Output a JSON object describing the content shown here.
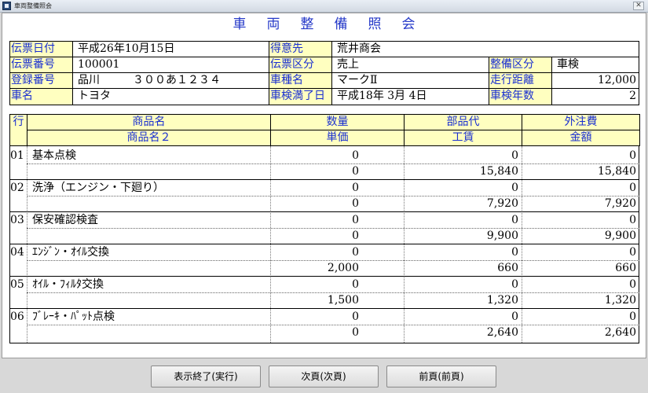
{
  "window": {
    "title": "車両整備照会"
  },
  "page": {
    "title": "車両整備照会"
  },
  "header": {
    "denpyo_hizuke": {
      "label": "伝票日付",
      "value": "平成26年10月15日"
    },
    "tokuisaki": {
      "label": "得意先",
      "value": "荒井商会"
    },
    "denpyo_bango": {
      "label": "伝票番号",
      "value": "100001"
    },
    "denpyo_kubun": {
      "label": "伝票区分",
      "value": "売上"
    },
    "seibi_kubun": {
      "label": "整備区分",
      "value": "車検"
    },
    "toroku_bango": {
      "label": "登録番号",
      "value": "品川　　　３００あ１２３４"
    },
    "shashu_mei": {
      "label": "車種名",
      "value": "マークⅡ"
    },
    "soko_kyori": {
      "label": "走行距離",
      "value": "12,000"
    },
    "shamei": {
      "label": "車名",
      "value": "トヨタ"
    },
    "shaken_manryobi": {
      "label": "車検満了日",
      "value": "平成18年 3月 4日"
    },
    "shaken_nensu": {
      "label": "車検年数",
      "value": "2"
    }
  },
  "table": {
    "headers": {
      "gyo": "行",
      "shohinmei": "商品名",
      "shohinmei2": "商品名２",
      "suryo": "数量",
      "tanka": "単価",
      "buhindai": "部品代",
      "kochin": "工賃",
      "gaichuhi": "外注費",
      "kingaku": "金額"
    },
    "rows": [
      {
        "no": "01",
        "name": "基本点検",
        "name2": "",
        "suryo": "0",
        "tanka": "0",
        "buhindai": "0",
        "kochin": "15,840",
        "gaichuhi": "0",
        "kingaku": "15,840"
      },
      {
        "no": "02",
        "name": "洗浄（エンジン・下廻り）",
        "name2": "",
        "suryo": "0",
        "tanka": "0",
        "buhindai": "0",
        "kochin": "7,920",
        "gaichuhi": "0",
        "kingaku": "7,920"
      },
      {
        "no": "03",
        "name": "保安確認検査",
        "name2": "",
        "suryo": "0",
        "tanka": "0",
        "buhindai": "0",
        "kochin": "9,900",
        "gaichuhi": "0",
        "kingaku": "9,900"
      },
      {
        "no": "04",
        "name": "ｴﾝｼﾞﾝ・ｵｲﾙ交換",
        "name2": "",
        "suryo": "0",
        "tanka": "2,000",
        "buhindai": "0",
        "kochin": "660",
        "gaichuhi": "0",
        "kingaku": "660"
      },
      {
        "no": "05",
        "name": "ｵｲﾙ・ﾌｨﾙﾀ交換",
        "name2": "",
        "suryo": "0",
        "tanka": "1,500",
        "buhindai": "0",
        "kochin": "1,320",
        "gaichuhi": "0",
        "kingaku": "1,320"
      },
      {
        "no": "06",
        "name": "ﾌﾞﾚｰｷ・ﾊﾟｯﾄ点検",
        "name2": "",
        "suryo": "0",
        "tanka": "0",
        "buhindai": "0",
        "kochin": "2,640",
        "gaichuhi": "0",
        "kingaku": "2,640"
      }
    ]
  },
  "buttons": {
    "exit": "表示終了(実行)",
    "next": "次頁(次頁)",
    "prev": "前頁(前頁)"
  }
}
